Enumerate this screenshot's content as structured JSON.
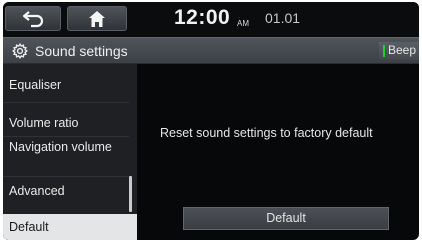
{
  "status_bar": {
    "back_icon": "back-arrow-icon",
    "home_icon": "home-icon",
    "time": "12:00",
    "ampm": "AM",
    "date": "01.01"
  },
  "title_bar": {
    "icon": "gear-icon",
    "title": "Sound settings",
    "beep_label": "Beep",
    "beep_indicator_color": "#19d22a"
  },
  "menu": {
    "items": [
      {
        "label": "Equaliser"
      },
      {
        "label": "Volume ratio"
      },
      {
        "label": "Navigation volume"
      },
      {
        "label": "Advanced"
      },
      {
        "label": "Default",
        "selected": true
      }
    ]
  },
  "main": {
    "message": "Reset sound settings to factory default",
    "button_label": "Default"
  }
}
